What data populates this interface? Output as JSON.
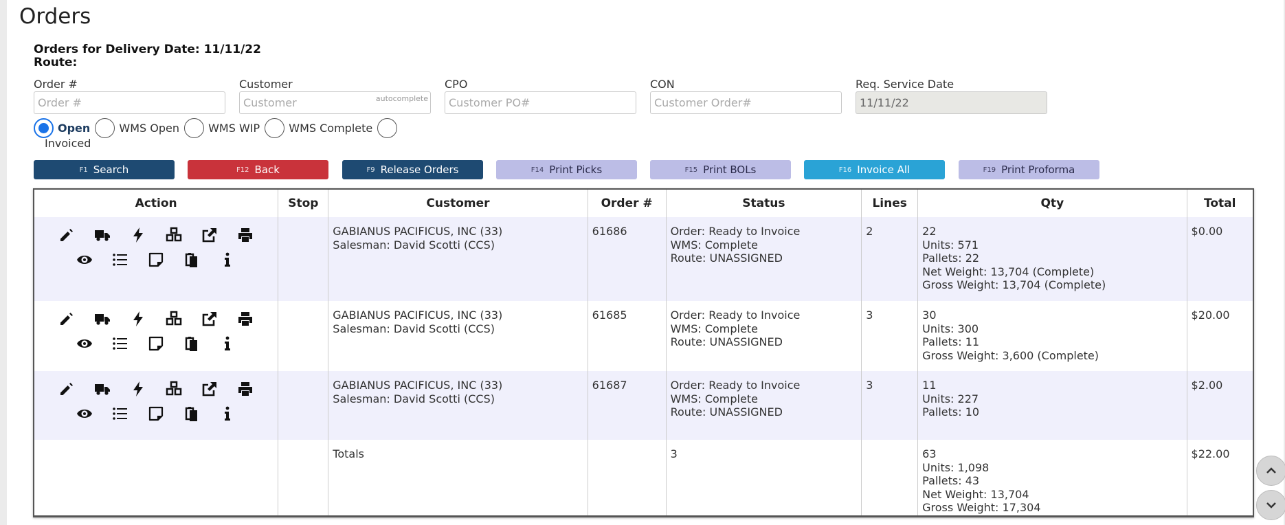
{
  "page": {
    "title": "Orders",
    "delivery_line": "Orders for Delivery Date: 11/11/22",
    "route_line": "Route:"
  },
  "filters": {
    "order": {
      "label": "Order #",
      "placeholder": "Order #",
      "value": ""
    },
    "customer": {
      "label": "Customer",
      "placeholder": "Customer",
      "value": "",
      "hint": "autocomplete"
    },
    "cpo": {
      "label": "CPO",
      "placeholder": "Customer PO#",
      "value": ""
    },
    "con": {
      "label": "CON",
      "placeholder": "Customer Order#",
      "value": ""
    },
    "service_date": {
      "label": "Req. Service Date",
      "value": "11/11/22",
      "disabled": true
    }
  },
  "status_options": [
    {
      "label": "Open",
      "selected": true
    },
    {
      "label": "WMS Open",
      "selected": false
    },
    {
      "label": "WMS WIP",
      "selected": false
    },
    {
      "label": "WMS Complete",
      "selected": false
    },
    {
      "label": "Invoiced",
      "selected": false
    }
  ],
  "buttons": [
    {
      "key": "F1",
      "label": "Search",
      "color": "#1e4a72"
    },
    {
      "key": "F12",
      "label": "Back",
      "color": "#c9333b"
    },
    {
      "key": "F9",
      "label": "Release Orders",
      "color": "#1e4a72"
    },
    {
      "key": "F14",
      "label": "Print Picks",
      "color": "#bcbde6"
    },
    {
      "key": "F15",
      "label": "Print BOLs",
      "color": "#bcbde6"
    },
    {
      "key": "F16",
      "label": "Invoice All",
      "color": "#2aa3d6"
    },
    {
      "key": "F19",
      "label": "Print Proforma",
      "color": "#bcbde6"
    }
  ],
  "table": {
    "columns": [
      "Action",
      "Stop",
      "Customer",
      "Order #",
      "Status",
      "Lines",
      "Qty",
      "Total"
    ],
    "action_icons": [
      "edit-icon",
      "truck-icon",
      "bolt-icon",
      "boxes-icon",
      "external-link-icon",
      "print-icon",
      "eye-icon",
      "list-icon",
      "note-icon",
      "copy-icon",
      "info-icon"
    ],
    "rows": [
      {
        "stop": "",
        "customer": "GABIANUS PACIFICUS, INC (33)",
        "salesman": "Salesman: David Scotti (CCS)",
        "order": "61686",
        "status": [
          "Order: Ready to Invoice",
          "WMS: Complete",
          "Route: UNASSIGNED"
        ],
        "lines": "2",
        "qty": [
          "22",
          "Units: 571",
          "Pallets: 22",
          "Net Weight: 13,704 (Complete)",
          "Gross Weight: 13,704 (Complete)"
        ],
        "total": "$0.00"
      },
      {
        "stop": "",
        "customer": "GABIANUS PACIFICUS, INC (33)",
        "salesman": "Salesman: David Scotti (CCS)",
        "order": "61685",
        "status": [
          "Order: Ready to Invoice",
          "WMS: Complete",
          "Route: UNASSIGNED"
        ],
        "lines": "3",
        "qty": [
          "30",
          "Units: 300",
          "Pallets: 11",
          "Gross Weight: 3,600 (Complete)"
        ],
        "total": "$20.00"
      },
      {
        "stop": "",
        "customer": "GABIANUS PACIFICUS, INC (33)",
        "salesman": "Salesman: David Scotti (CCS)",
        "order": "61687",
        "status": [
          "Order: Ready to Invoice",
          "WMS: Complete",
          "Route: UNASSIGNED"
        ],
        "lines": "3",
        "qty": [
          "11",
          "Units: 227",
          "Pallets: 10"
        ],
        "total": "$2.00"
      }
    ],
    "totals": {
      "label": "Totals",
      "status": "3",
      "qty": [
        "63",
        "Units: 1,098",
        "Pallets: 43",
        "Net Weight: 13,704",
        "Gross Weight: 17,304"
      ],
      "total": "$22.00"
    }
  },
  "scroll": {
    "up_icon": "chevron-up-icon",
    "down_icon": "chevron-down-icon"
  }
}
